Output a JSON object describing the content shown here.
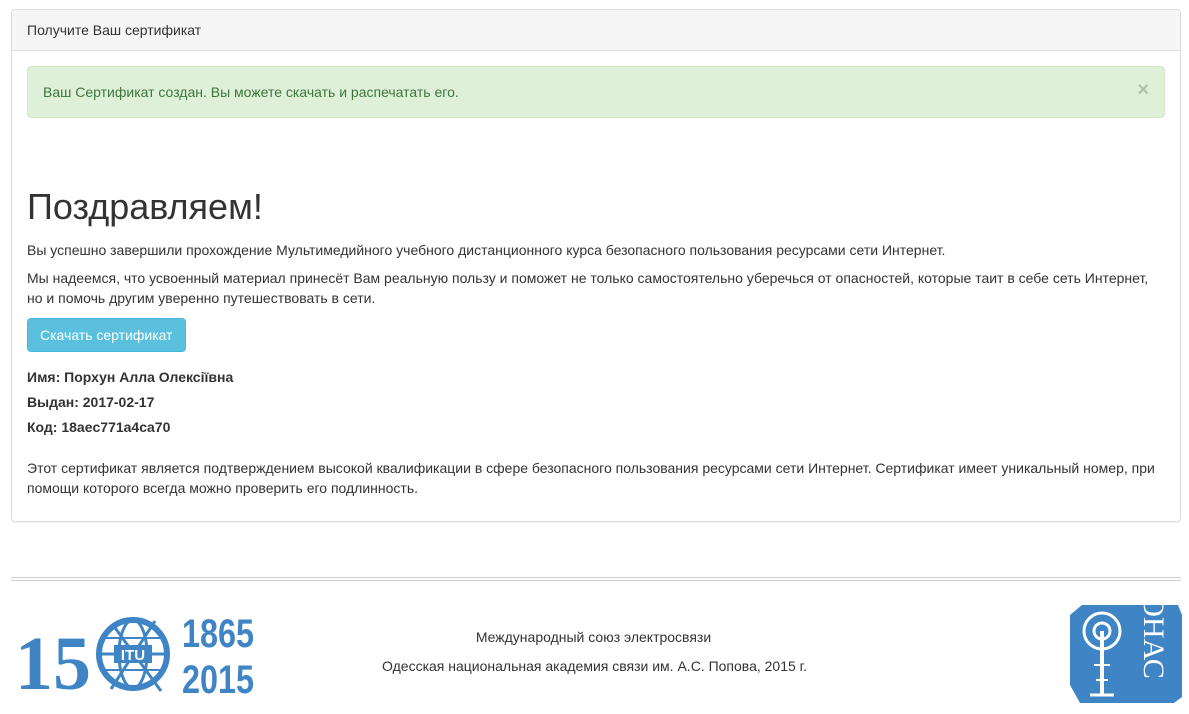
{
  "panel": {
    "heading": "Получите Ваш сертификат",
    "alert": {
      "text": "Ваш Сертификат создан. Вы можете скачать и распечатать его.",
      "close": "×"
    }
  },
  "content": {
    "title": "Поздравляем!",
    "paragraph1": "Вы успешно завершили прохождение Мультимедийного учебного дистанционного курса безопасного пользования ресурсами сети Интернет.",
    "paragraph2": "Мы надеемся, что усвоенный материал принесёт Вам реальную пользу и поможет не только самостоятельно уберечься от опасностей, которые таит в себе сеть Интернет, но и помочь другим уверенно путешествовать в сети.",
    "download_button": "Скачать сертификат",
    "name": "Имя: Порхун Алла Олексіївна",
    "issued": "Выдан: 2017-02-17",
    "code": "Код: 18aec771a4ca70",
    "paragraph3": "Этот сертификат является подтверждением высокой квалификации в сфере безопасного пользования ресурсами сети Интернет. Сертификат имеет уникальный номер, при помощи которого всегда можно проверить его подлинность."
  },
  "footer": {
    "line1": "Международный союз электросвязи",
    "line2": "Одесская национальная академия связи им. А.С. Попова, 2015 г.",
    "itu_logo": {
      "number": "15",
      "acronym": "ITU",
      "year_start": "1865",
      "year_end": "2015",
      "color": "#3f85c6"
    },
    "onas_logo": {
      "letters": "ОНАС",
      "color": "#3f85c6"
    }
  },
  "colors": {
    "alert_bg": "#dff0d8",
    "alert_text": "#3c763d",
    "button_bg": "#5bc0de",
    "logo_blue": "#3f85c6"
  }
}
